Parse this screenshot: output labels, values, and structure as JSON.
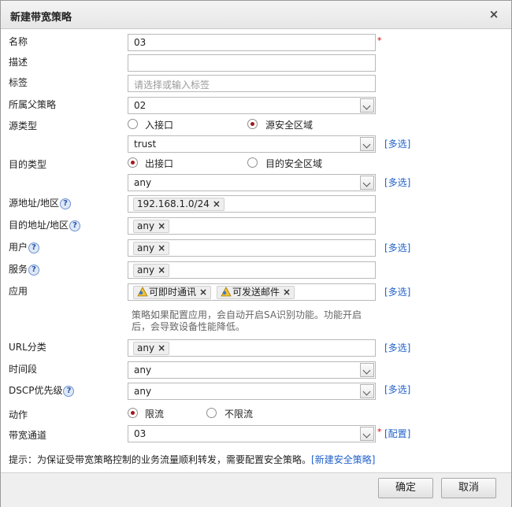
{
  "dialog": {
    "title": "新建带宽策略",
    "close_glyph": "×"
  },
  "form": {
    "name": {
      "label": "名称",
      "value": "03"
    },
    "description": {
      "label": "描述",
      "value": ""
    },
    "tag": {
      "label": "标签",
      "placeholder": "请选择或输入标签"
    },
    "parent_policy": {
      "label": "所属父策略",
      "value": "02"
    },
    "source_type": {
      "label": "源类型",
      "options": [
        "入接口",
        "源安全区域"
      ],
      "selected": "源安全区域",
      "value": "trust"
    },
    "dest_type": {
      "label": "目的类型",
      "options": [
        "出接口",
        "目的安全区域"
      ],
      "selected": "出接口",
      "value": "any"
    },
    "source_address": {
      "label": "源地址/地区",
      "chips": [
        "192.168.1.0/24"
      ]
    },
    "dest_address": {
      "label": "目的地址/地区",
      "chips": [
        "any"
      ]
    },
    "user": {
      "label": "用户",
      "chips": [
        "any"
      ]
    },
    "service": {
      "label": "服务",
      "chips": [
        "any"
      ]
    },
    "application": {
      "label": "应用",
      "chips": [
        "可即时通讯",
        "可发送邮件"
      ]
    },
    "app_note": "策略如果配置应用，会自动开启SA识别功能。功能开启后，会导致设备性能降低。",
    "url_category": {
      "label": "URL分类",
      "chips": [
        "any"
      ]
    },
    "time_range": {
      "label": "时间段",
      "value": "any"
    },
    "dscp": {
      "label": "DSCP优先级",
      "value": "any"
    },
    "action": {
      "label": "动作",
      "options": [
        "限流",
        "不限流"
      ],
      "selected": "限流"
    },
    "bandwidth_channel": {
      "label": "带宽通道",
      "value": "03"
    }
  },
  "links": {
    "multi_select": "[多选]",
    "configure": "[配置]"
  },
  "required_mark": "*",
  "help_glyph": "?",
  "chip_remove": "×",
  "tip": {
    "text": "提示：为保证受带宽策略控制的业务流量顺利转发，需要配置安全策略。",
    "link": "[新建安全策略]"
  },
  "buttons": {
    "ok": "确定",
    "cancel": "取消"
  },
  "colors": {
    "link": "#2162c9",
    "required": "#d40000",
    "radio_selected": "#a11a1a"
  }
}
